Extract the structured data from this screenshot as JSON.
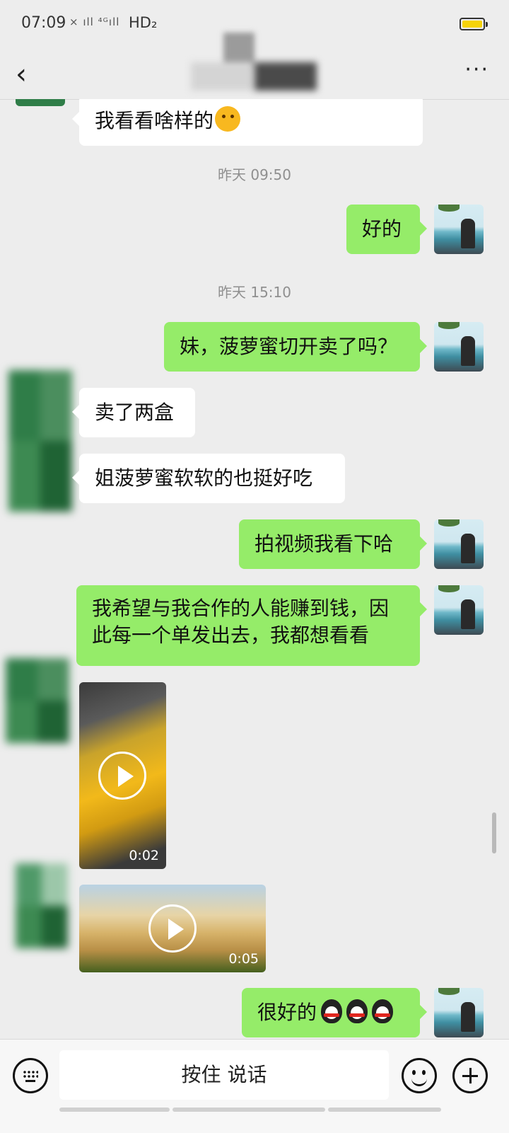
{
  "status_bar": {
    "time": "07:09",
    "signal_text": "× ıll ⁴ᴳıll",
    "network": "HD₂"
  },
  "header": {
    "back_label": "‹",
    "more_label": "···"
  },
  "messages": [
    {
      "type": "in",
      "text": "我看看啥样的",
      "emoji": "wink-emoji"
    },
    {
      "type": "time",
      "text": "昨天 09:50"
    },
    {
      "type": "out",
      "text": "好的"
    },
    {
      "type": "time",
      "text": "昨天 15:10"
    },
    {
      "type": "out",
      "text": "妹，菠萝蜜切开卖了吗？"
    },
    {
      "type": "in",
      "text": "卖了两盒"
    },
    {
      "type": "in",
      "text": "姐菠萝蜜软软的也挺好吃"
    },
    {
      "type": "out",
      "text": "拍视频我看下哈"
    },
    {
      "type": "out",
      "text_line1": "我希望与我合作的人能赚到钱，因",
      "text_line2": "此每一个单发出去，我都想看看"
    },
    {
      "type": "in_video",
      "duration": "0:02"
    },
    {
      "type": "in_video",
      "duration": "0:05"
    },
    {
      "type": "out",
      "text": "很好的",
      "emoji": "penguin-emoji"
    }
  ],
  "input_bar": {
    "talk_label": "按住 说话"
  },
  "colors": {
    "background": "#ededed",
    "incoming_bubble": "#ffffff",
    "outgoing_bubble": "#95ec69",
    "timestamp": "#8f8f8f"
  }
}
